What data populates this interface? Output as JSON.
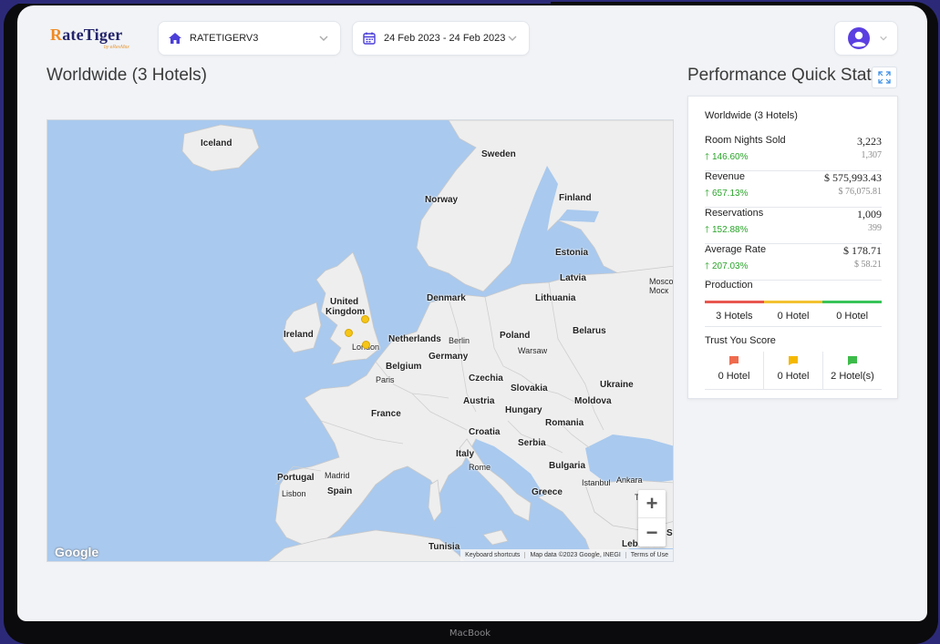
{
  "header": {
    "logo_text": "RateTiger",
    "logo_sub": "by eRevMax",
    "hotel_select": "RATETIGERV3",
    "date_range": "24 Feb 2023 - 24 Feb 2023"
  },
  "map_section": {
    "title": "Worldwide (3 Hotels)",
    "labels": {
      "iceland": "Iceland",
      "sweden": "Sweden",
      "norway": "Norway",
      "finland": "Finland",
      "estonia": "Estonia",
      "latvia": "Latvia",
      "moscow": "Mosco",
      "moscow2": "Моск",
      "uk": "United",
      "uk2": "Kingdom",
      "denmark": "Denmark",
      "lithuania": "Lithuania",
      "ireland": "Ireland",
      "netherlands": "Netherlands",
      "berlin": "Berlin",
      "poland": "Poland",
      "warsaw": "Warsaw",
      "belarus": "Belarus",
      "london": "London",
      "germany": "Germany",
      "belgium": "Belgium",
      "paris": "Paris",
      "czechia": "Czechia",
      "slovakia": "Slovakia",
      "ukraine": "Ukraine",
      "austria": "Austria",
      "moldova": "Moldova",
      "hungary": "Hungary",
      "france": "France",
      "romania": "Romania",
      "croatia": "Croatia",
      "serbia": "Serbia",
      "italy": "Italy",
      "rome": "Rome",
      "bulgaria": "Bulgaria",
      "portugal": "Portugal",
      "madrid": "Madrid",
      "lisbon": "Lisbon",
      "spain": "Spain",
      "istanbul": "Istanbul",
      "ankara": "Ankara",
      "greece": "Greece",
      "tunisia": "Tunisia",
      "lebanon": "Lebanon",
      "sy": "Sy",
      "t": "T"
    },
    "zoom_in": "+",
    "zoom_out": "−",
    "google": "Google",
    "attribution": [
      "Keyboard shortcuts",
      "Map data ©2023 Google, INEGI",
      "Terms of Use"
    ]
  },
  "stats": {
    "title": "Performance Quick Stats",
    "scope": "Worldwide (3 Hotels)",
    "rows": [
      {
        "name": "Room Nights Sold",
        "value": "3,223",
        "change": "146.60%",
        "previous": "1,307"
      },
      {
        "name": "Revenue",
        "value": "$ 575,993.43",
        "change": "657.13%",
        "previous": "$ 76,075.81"
      },
      {
        "name": "Reservations",
        "value": "1,009",
        "change": "152.88%",
        "previous": "399"
      },
      {
        "name": "Average Rate",
        "value": "$ 178.71",
        "change": "207.03%",
        "previous": "$ 58.21"
      }
    ],
    "production": {
      "title": "Production",
      "cells": [
        "3 Hotels",
        "0 Hotel",
        "0 Hotel"
      ],
      "colors": [
        "#e8574f",
        "#f2c230",
        "#38c45a"
      ]
    },
    "trust": {
      "title": "Trust You Score",
      "cells": [
        "0 Hotel",
        "0 Hotel",
        "2 Hotel(s)"
      ],
      "colors": [
        "#ef6b4e",
        "#f5b800",
        "#3dbb4a"
      ]
    }
  },
  "device_label": "MacBook"
}
